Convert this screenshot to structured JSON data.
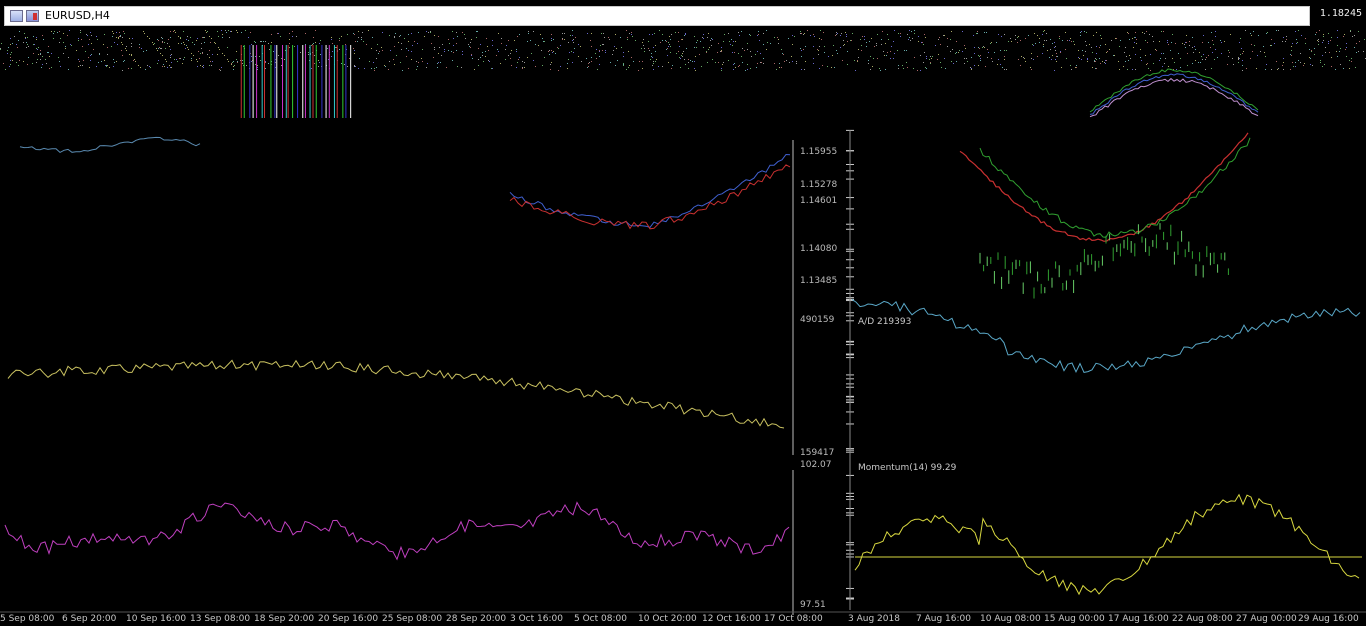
{
  "window": {
    "title": "EURUSD,H4",
    "current_price": "1.18245"
  },
  "price_axis": {
    "labels": [
      "1.15955",
      "1.15278",
      "1.14601",
      "1.14080",
      "1.13485"
    ]
  },
  "ad_axis": {
    "labels": [
      "490159",
      "159417"
    ]
  },
  "momentum_axis": {
    "labels": [
      "102.07",
      "97.51"
    ]
  },
  "indicators": {
    "ad_label": "A/D 219393",
    "momentum_label": "Momentum(14) 99.29"
  },
  "time_axis_left": {
    "labels": [
      "5 Sep 08:00",
      "6 Sep 20:00",
      "10 Sep 16:00",
      "13 Sep 08:00",
      "18 Sep 20:00",
      "20 Sep 16:00",
      "25 Sep 08:00",
      "28 Sep 20:00",
      "3 Oct 16:00",
      "5 Oct 08:00",
      "10 Oct 20:00",
      "12 Oct 16:00",
      "17 Oct 08:00"
    ]
  },
  "time_axis_right": {
    "labels": [
      "3 Aug 2018",
      "7 Aug 16:00",
      "10 Aug 08:00",
      "15 Aug 00:00",
      "17 Aug 16:00",
      "22 Aug 08:00",
      "27 Aug 00:00",
      "29 Aug 16:00"
    ]
  },
  "colors": {
    "ad_line_left": "#c8c060",
    "ad_line_right": "#5aa8c8",
    "momentum_left": "#c040c0",
    "momentum_right": "#d8d840",
    "ma_red": "#c83030",
    "ma_green": "#30a030",
    "ma_blue": "#4060d0"
  }
}
